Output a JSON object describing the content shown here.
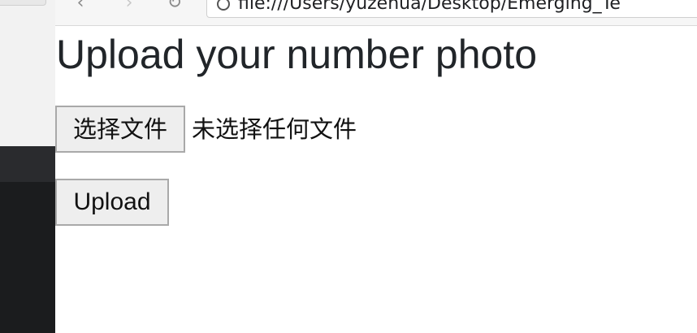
{
  "browser": {
    "url": "file:///Users/yuzehua/Desktop/Emerging_Te"
  },
  "page": {
    "title": "Upload your number photo",
    "file_input": {
      "button_label": "选择文件",
      "status_text": "未选择任何文件"
    },
    "upload_button_label": "Upload"
  },
  "icons": {
    "back": "back-arrow-icon",
    "forward": "forward-arrow-icon",
    "reload": "reload-icon",
    "info": "info-icon"
  }
}
